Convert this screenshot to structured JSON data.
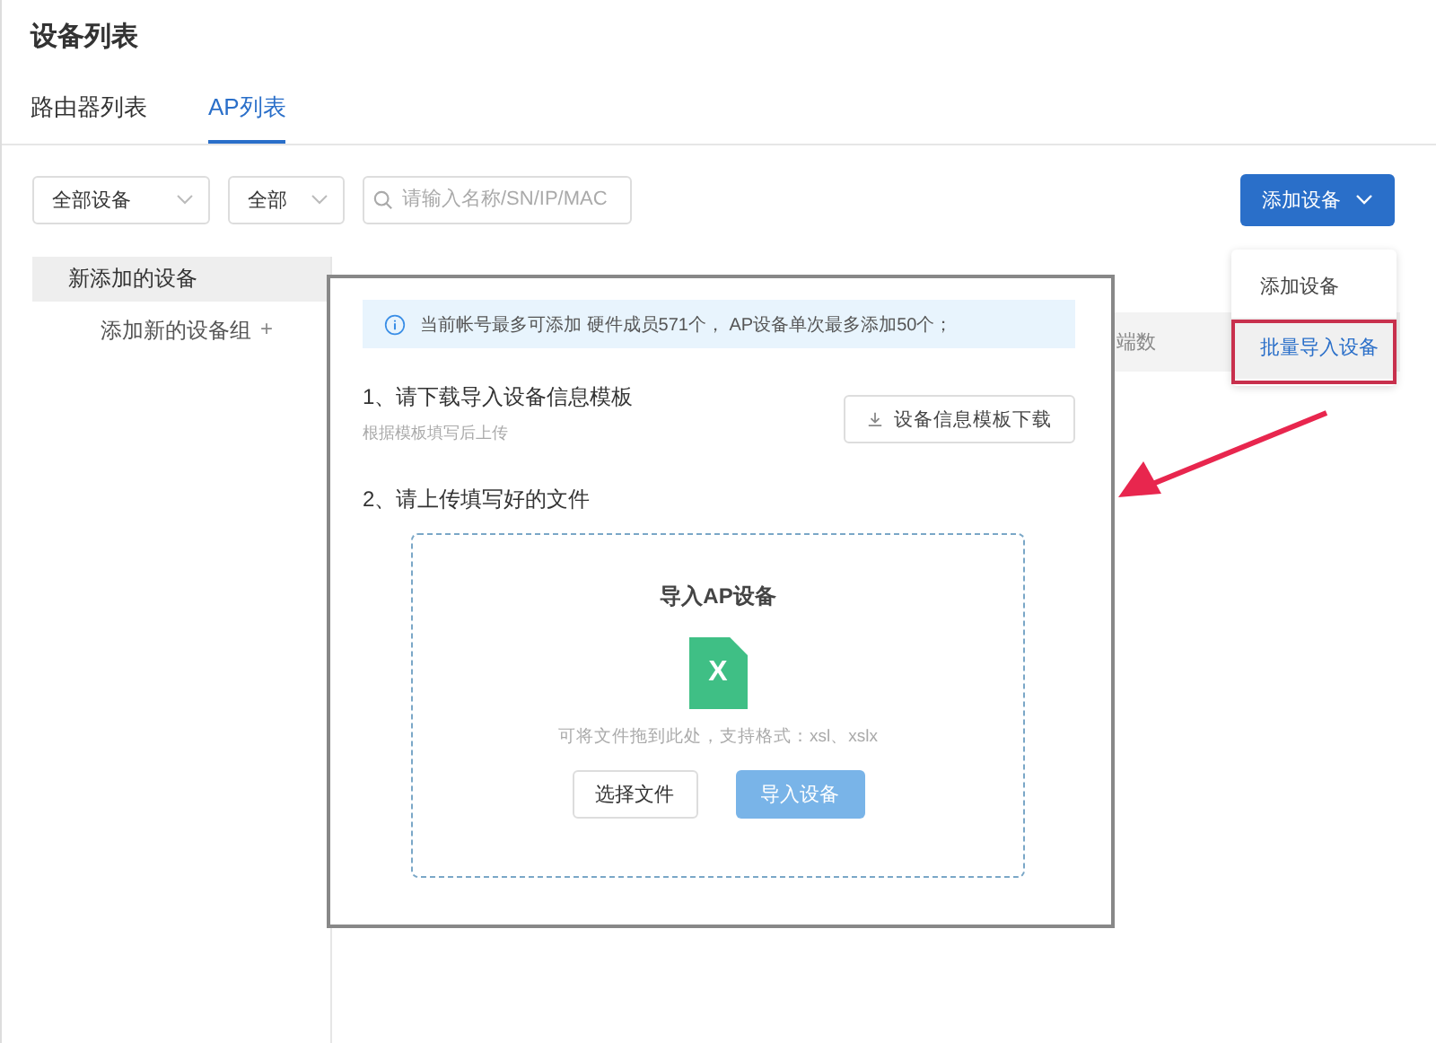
{
  "page_title": "设备列表",
  "tabs": [
    {
      "label": "路由器列表",
      "selected": false
    },
    {
      "label": "AP列表",
      "selected": true
    }
  ],
  "filters": {
    "device_select": "全部设备",
    "status_select": "全部",
    "search": {
      "placeholder": "请输入名称/SN/IP/MAC"
    }
  },
  "add_button": "添加设备",
  "add_menu": [
    {
      "label": "添加设备",
      "selected": false
    },
    {
      "label": "批量导入设备",
      "selected": true
    }
  ],
  "sidebar": {
    "items": [
      {
        "label": "新添加的设备",
        "selected": true
      }
    ],
    "add_group": "添加新的设备组",
    "add_icon": "+"
  },
  "table": {
    "columns": [
      "端数"
    ]
  },
  "import_dialog": {
    "notice": "当前帐号最多可添加 硬件成员571个， AP设备单次最多添加50个；",
    "step1": "1、请下载导入设备信息模板",
    "step1_hint": "根据模板填写后上传",
    "download_button": "设备信息模板下载",
    "step2": "2、请上传填写好的文件",
    "dropzone": {
      "title": "导入AP设备",
      "file_icon_letter": "X",
      "hint": "可将文件拖到此处，支持格式：xsl、xslx",
      "buttons": [
        {
          "label": "选择文件",
          "kind": "default",
          "disabled": false
        },
        {
          "label": "导入设备",
          "kind": "primary",
          "disabled": true
        }
      ]
    }
  }
}
